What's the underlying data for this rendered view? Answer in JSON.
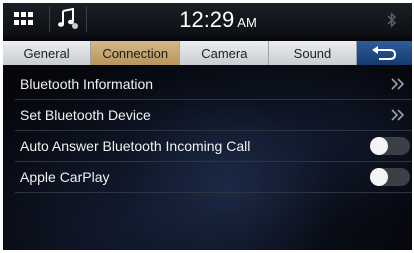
{
  "status_bar": {
    "time": "12:29",
    "ampm": "AM",
    "icons": [
      "grid-icon",
      "music-note-icon",
      "bluetooth-icon"
    ]
  },
  "tabs": [
    {
      "label": "General",
      "active": false
    },
    {
      "label": "Connection",
      "active": true
    },
    {
      "label": "Camera",
      "active": false
    },
    {
      "label": "Sound",
      "active": false
    }
  ],
  "back_icon": "return-arrow-icon",
  "settings": [
    {
      "label": "Bluetooth Information",
      "control": "chevron"
    },
    {
      "label": "Set Bluetooth Device",
      "control": "chevron"
    },
    {
      "label": "Auto Answer Bluetooth Incoming Call",
      "control": "toggle",
      "value": "off"
    },
    {
      "label": "Apple CarPlay",
      "control": "toggle",
      "value": "off"
    }
  ],
  "colors": {
    "active_tab": "#c4a46c",
    "back_button": "#1f4a85",
    "background": "#05070c"
  }
}
